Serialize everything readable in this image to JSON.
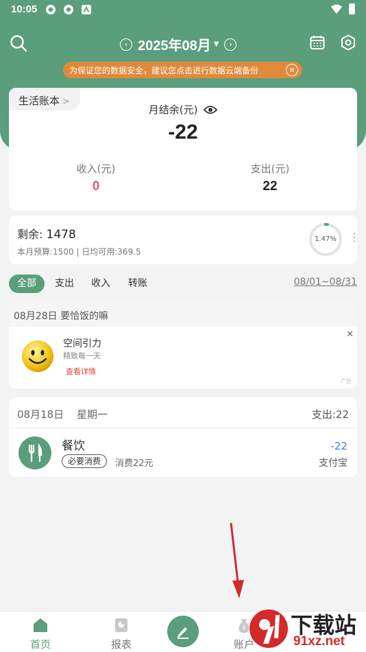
{
  "status_bar": {
    "time": "10:05"
  },
  "header": {
    "month": "2025年08月"
  },
  "notice": {
    "text": "为保证您的数据安全，建议您点击进行数据云端备份"
  },
  "summary": {
    "book_name": "生活账本",
    "balance_label": "月结余(元)",
    "balance_value": "-22",
    "income_label": "收入(元)",
    "income_value": "0",
    "expense_label": "支出(元)",
    "expense_value": "22"
  },
  "budget": {
    "remaining_label": "剩余:",
    "remaining_value": "1478",
    "detail": "本月预算:1500 | 日均可用:369.5",
    "percent_text": "1.47%",
    "percent_used": 0.0147
  },
  "filters": {
    "tabs": [
      "全部",
      "支出",
      "收入",
      "转账"
    ],
    "date_range": "08/01~08/31"
  },
  "ad": {
    "header": "08月28日  要恰饭的嘛",
    "title": "空间引力",
    "desc": "精致每一天",
    "link": "查看详情",
    "tag": "广告"
  },
  "record": {
    "date": "08月18日",
    "weekday": "星期一",
    "day_expense": "支出:22",
    "category": "餐饮",
    "tag": "必要消费",
    "note": "消费22元",
    "amount": "-22",
    "method": "支付宝"
  },
  "bottom_nav": {
    "home": "首页",
    "report": "报表",
    "account": "账户"
  },
  "watermark": {
    "line1": "下载站",
    "line2": "91xz.net"
  },
  "colors": {
    "primary": "#5a9e7b",
    "notice": "#e08a3c",
    "income": "#e05a7a",
    "amount": "#3f7fd0"
  }
}
